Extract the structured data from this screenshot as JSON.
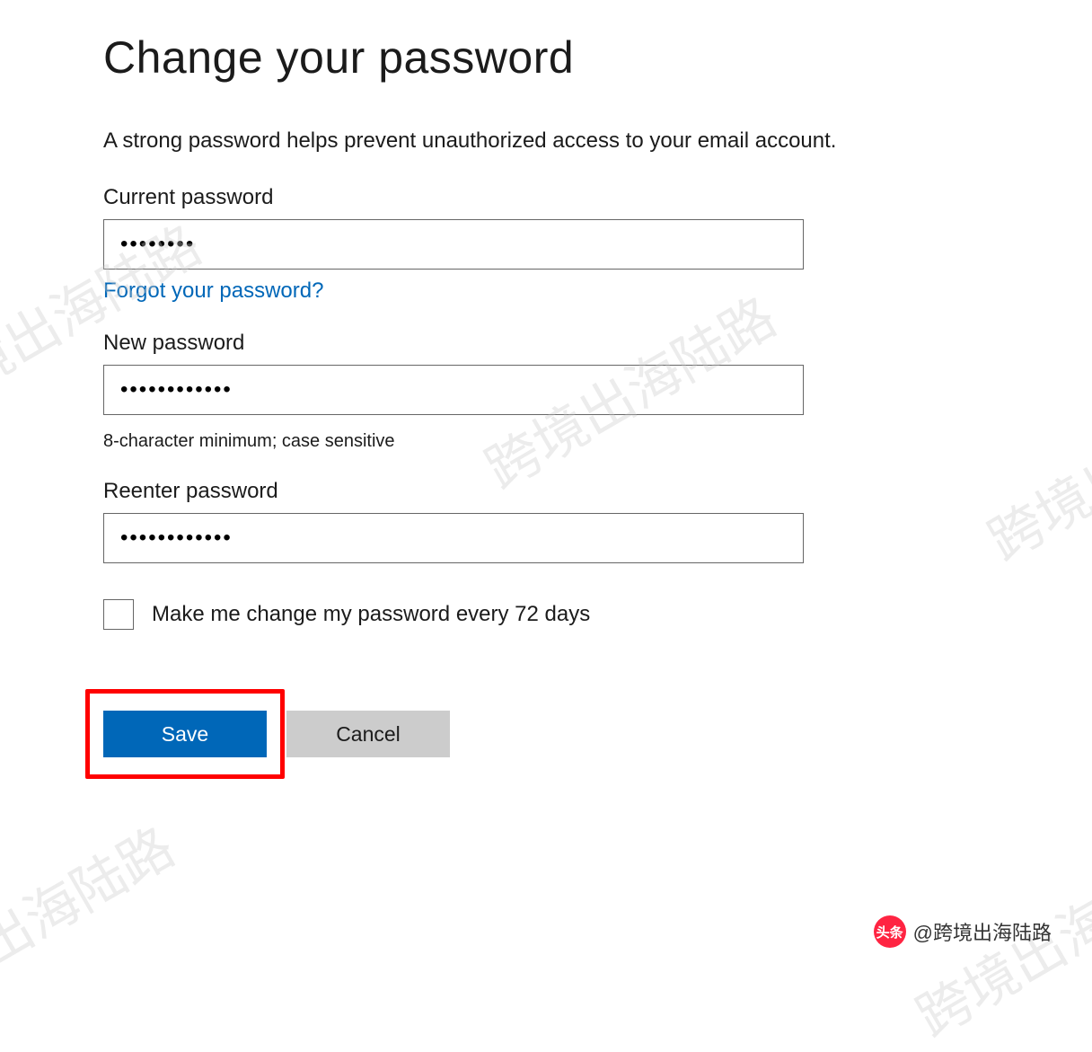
{
  "header": {
    "title": "Change your password"
  },
  "description": "A strong password helps prevent unauthorized access to your email account.",
  "fields": {
    "current": {
      "label": "Current password",
      "value": "••••••••",
      "forgot_link": "Forgot your password?"
    },
    "new": {
      "label": "New password",
      "value": "••••••••••••",
      "hint": "8-character minimum; case sensitive"
    },
    "reenter": {
      "label": "Reenter password",
      "value": "••••••••••••"
    }
  },
  "checkbox": {
    "label": "Make me change my password every 72 days",
    "checked": false
  },
  "buttons": {
    "save": "Save",
    "cancel": "Cancel"
  },
  "attribution": {
    "prefix": "头条",
    "handle": "@跨境出海陆路"
  },
  "watermark_text": "跨境出海陆路",
  "colors": {
    "primary": "#0067b8",
    "highlight": "#ff0000"
  }
}
